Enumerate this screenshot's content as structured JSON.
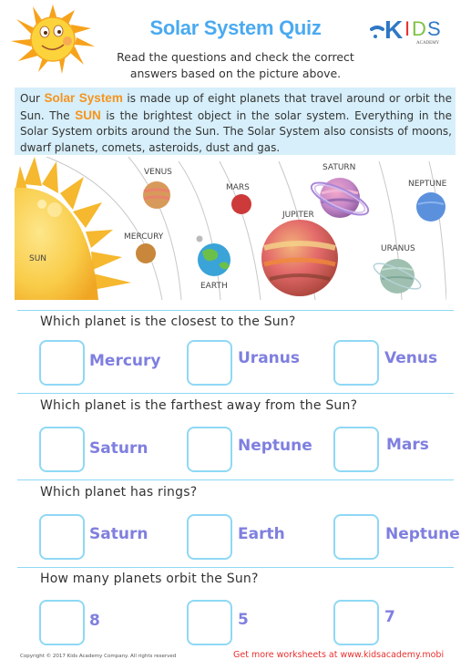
{
  "header": {
    "title": "Solar System Quiz",
    "subtitle_line1": "Read the questions and check the correct",
    "subtitle_line2": "answers based on the picture above.",
    "logo": {
      "text": "KIDS",
      "subtext": "ACADEMY",
      "letter_colors": [
        "#2f78c4",
        "#e7302a",
        "#7dc242",
        "#2f78c4"
      ]
    },
    "mascot_icon": "smiling-sun-icon"
  },
  "info": {
    "part1": "Our ",
    "highlight1": "Solar System",
    "part2": " is made up of eight planets that travel around or orbit the Sun. The ",
    "highlight2": "SUN",
    "part3": " is the brightest object in the solar system. Everything in the Solar System orbits around the Sun. The Solar System also consists of moons, dwarf planets, comets, asteroids, dust and gas."
  },
  "scene": {
    "labels": {
      "sun": "SUN",
      "mercury": "MERCURY",
      "venus": "VENUS",
      "earth": "EARTH",
      "mars": "MARS",
      "jupiter": "JUPITER",
      "saturn": "SATURN",
      "uranus": "URANUS",
      "neptune": "NEPTUNE"
    }
  },
  "questions": [
    {
      "text": "Which planet is the closest to the Sun?",
      "options": [
        "Mercury",
        "Uranus",
        "Venus"
      ]
    },
    {
      "text": "Which planet is the farthest away from the Sun?",
      "options": [
        "Saturn",
        "Neptune",
        "Mars"
      ]
    },
    {
      "text": "Which planet has rings?",
      "options": [
        "Saturn",
        "Earth",
        "Neptune"
      ]
    },
    {
      "text": "How many planets orbit the Sun?",
      "options": [
        "8",
        "5",
        "7"
      ]
    }
  ],
  "footer": {
    "copyright": "Copyright © 2017 Kids Academy Company. All rights reserved",
    "promo": "Get more worksheets at www.kidsacademy.mobi"
  },
  "colors": {
    "title": "#4aaaf0",
    "highlight": "#f7941d",
    "info_bg": "#d6effa",
    "checkbox_border": "#8fd8f5",
    "option_text": "#7f7fe0",
    "promo_text": "#e8302e"
  }
}
